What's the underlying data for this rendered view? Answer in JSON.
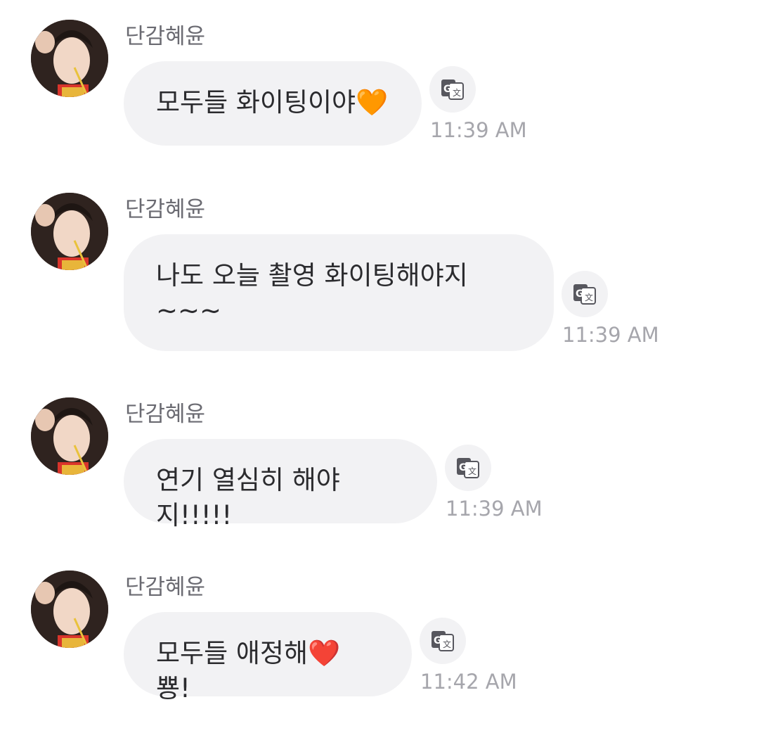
{
  "messages": [
    {
      "sender": "단감혜윤",
      "text": "모두들 화이팅이야🧡",
      "time": "11:39 AM"
    },
    {
      "sender": "단감혜윤",
      "text": "나도 오늘 촬영 화이팅해야지\n~~~",
      "time": "11:39 AM"
    },
    {
      "sender": "단감혜윤",
      "text": "연기 열심히 해야지!!!!!",
      "time": "11:39 AM"
    },
    {
      "sender": "단감혜윤",
      "text": "모두들 애정해❤️ 뿅!",
      "time": "11:42 AM"
    }
  ],
  "icons": {
    "translate": "translate-icon",
    "avatar": "profile-photo"
  },
  "colors": {
    "bubble": "#f2f2f4",
    "sender": "#6b6b72",
    "timestamp": "#a6a6ac",
    "text": "#2b2b2e"
  }
}
